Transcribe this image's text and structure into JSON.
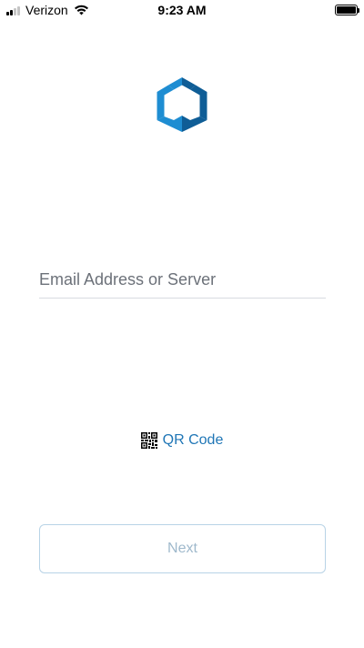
{
  "status_bar": {
    "carrier": "Verizon",
    "time": "9:23 AM",
    "signal_bars_active": 2,
    "signal_bars_total": 4,
    "battery_level": 1.0
  },
  "logo": {
    "icon": "hexagon-logo-icon",
    "color_dark": "#0f5d96",
    "color_light": "#1e8dd2"
  },
  "login": {
    "email_placeholder": "Email Address or Server",
    "email_value": "",
    "qr_icon": "qr-code-icon",
    "qr_label": "QR Code",
    "next_label": "Next",
    "next_enabled": false
  },
  "colors": {
    "accent": "#1f76b6",
    "button_border": "#b8d3e6",
    "button_text_disabled": "#9fb9cc"
  }
}
